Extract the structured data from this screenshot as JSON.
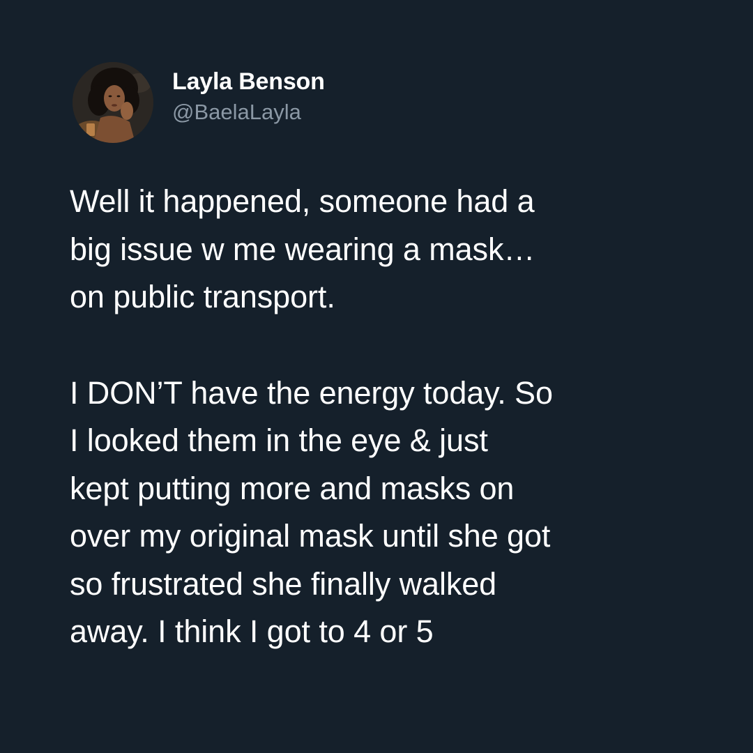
{
  "author": {
    "display_name": "Layla Benson",
    "handle": "@BaelaLayla"
  },
  "tweet": {
    "paragraphs": [
      {
        "lines": [
          "Well it happened, someone had a",
          "big issue w me wearing a mask…",
          "on public transport."
        ]
      },
      {
        "lines": [
          "I DON’T have the energy today. So",
          "I looked them in the eye & just",
          "kept putting more and masks on",
          "over my original mask until she got",
          "so frustrated she finally walked",
          "away. I think I got to 4 or 5"
        ]
      }
    ]
  },
  "colors": {
    "background": "#15202b",
    "text_primary": "#ffffff",
    "text_secondary": "#8b98a5"
  }
}
